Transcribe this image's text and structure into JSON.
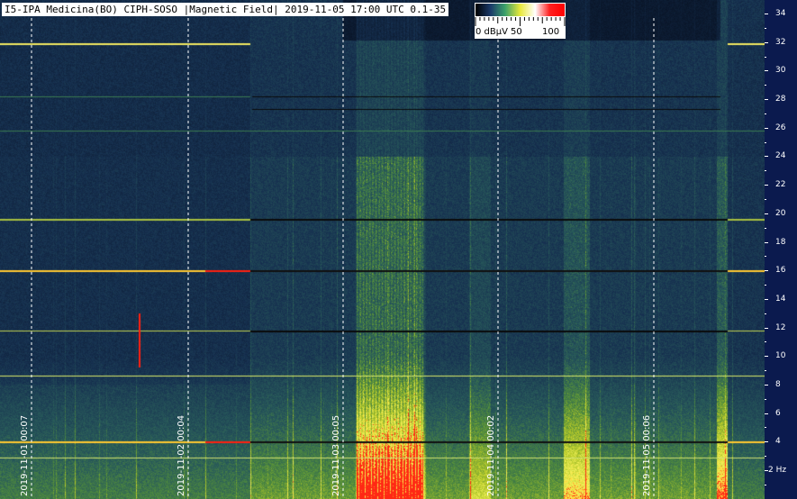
{
  "title": "I5-IPA Medicina(BO) CIPH-SOSO |Magnetic Field| 2019-11-05 17:00 UTC 0.1-35",
  "colorbar": {
    "labels": [
      "0 dBµV",
      "50",
      "100"
    ],
    "colors": [
      "#000000",
      "#1a3a6a",
      "#3aa06a",
      "#e8e83a",
      "#ffffff",
      "#ff2020",
      "#ff0000"
    ]
  },
  "chart_data": {
    "type": "heatmap",
    "title": "I5-IPA Medicina(BO) CIPH-SOSO |Magnetic Field| 2019-11-05 17:00 UTC 0.1-35",
    "ylabel": "Hz",
    "ylim": [
      0.1,
      35
    ],
    "y_ticks": [
      2,
      4,
      6,
      8,
      10,
      12,
      14,
      16,
      18,
      20,
      22,
      24,
      26,
      28,
      30,
      32,
      34
    ],
    "y_tick_labels": [
      "2 Hz",
      "4",
      "6",
      "8",
      "10",
      "12",
      "14",
      "16",
      "18",
      "20",
      "22",
      "24",
      "26",
      "28",
      "30",
      "32",
      "34"
    ],
    "x_markers": [
      "2019-11-01 00:07",
      "2019-11-02 00:04",
      "2019-11-03 00:05",
      "2019-11-04 00:02",
      "2019-11-05 00:06"
    ],
    "color_scale": {
      "min": 0,
      "max": 100,
      "unit": "dBµV"
    },
    "grid": true
  }
}
